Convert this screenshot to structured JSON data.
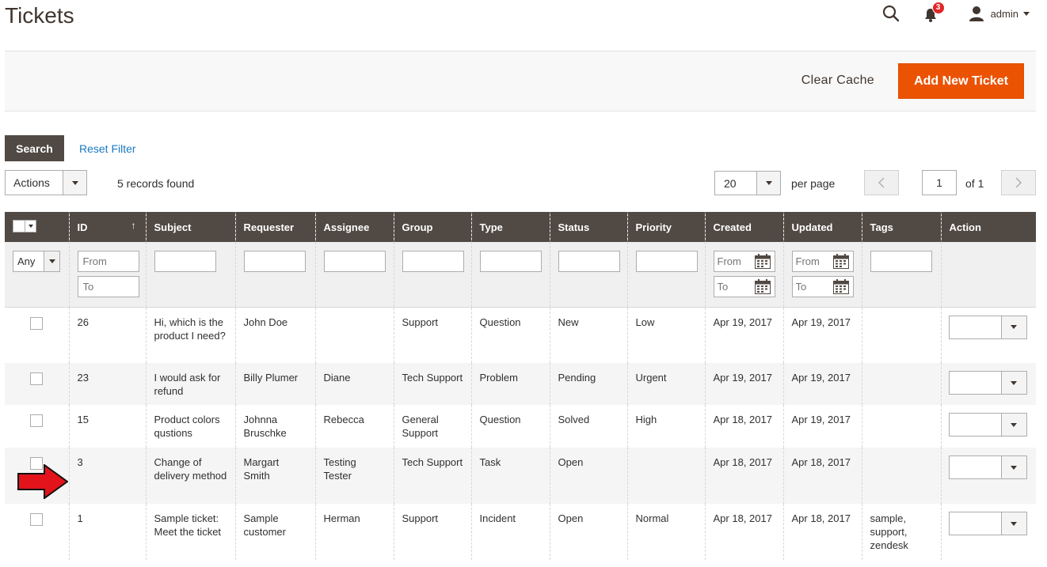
{
  "header": {
    "title": "Tickets",
    "notifications_count": "3",
    "user_name": "admin"
  },
  "action_bar": {
    "clear_cache_label": "Clear Cache",
    "add_new_label": "Add New Ticket"
  },
  "toolbar": {
    "search_label": "Search",
    "reset_filter_label": "Reset Filter",
    "actions_label": "Actions",
    "records_found": "5 records found",
    "per_page_value": "20",
    "per_page_label": "per page",
    "current_page": "1",
    "page_of": "of 1"
  },
  "grid": {
    "columns": [
      "ID",
      "Subject",
      "Requester",
      "Assignee",
      "Group",
      "Type",
      "Status",
      "Priority",
      "Created",
      "Updated",
      "Tags",
      "Action"
    ],
    "sort_indicator": "↑",
    "filters": {
      "any_label": "Any",
      "from_placeholder": "From",
      "to_placeholder": "To"
    },
    "rows": [
      {
        "id": "26",
        "subject": "Hi, which is the product I need?",
        "requester": "John Doe",
        "assignee": "",
        "group": "Support",
        "type": "Question",
        "status": "New",
        "priority": "Low",
        "created": "Apr 19, 2017",
        "updated": "Apr 19, 2017",
        "tags": ""
      },
      {
        "id": "23",
        "subject": "I would ask for refund",
        "requester": "Billy Plumer",
        "assignee": "Diane",
        "group": "Tech Support",
        "type": "Problem",
        "status": "Pending",
        "priority": "Urgent",
        "created": "Apr 19, 2017",
        "updated": "Apr 19, 2017",
        "tags": ""
      },
      {
        "id": "15",
        "subject": "Product colors qustions",
        "requester": "Johnna Bruschke",
        "assignee": "Rebecca",
        "group": "General Support",
        "type": "Question",
        "status": "Solved",
        "priority": "High",
        "created": "Apr 18, 2017",
        "updated": "Apr 19, 2017",
        "tags": ""
      },
      {
        "id": "3",
        "subject": "Change of delivery method",
        "requester": "Margart Smith",
        "assignee": "Testing Tester",
        "group": "Tech Support",
        "type": "Task",
        "status": "Open",
        "priority": "",
        "created": "Apr 18, 2017",
        "updated": "Apr 18, 2017",
        "tags": ""
      },
      {
        "id": "1",
        "subject": "Sample ticket: Meet the ticket",
        "requester": "Sample customer",
        "assignee": "Herman",
        "group": "Support",
        "type": "Incident",
        "status": "Open",
        "priority": "Normal",
        "created": "Apr 18, 2017",
        "updated": "Apr 18, 2017",
        "tags": "sample, support, zendesk"
      }
    ]
  },
  "icons": {
    "search": "search-icon",
    "bell": "bell-icon",
    "user": "user-icon",
    "calendar": "calendar-icon",
    "arrow": "red-arrow-icon"
  },
  "colors": {
    "accent": "#eb5202",
    "header_bg": "#514943",
    "link": "#1979c3",
    "badge": "#e22626",
    "arrow": "#e3131b"
  }
}
